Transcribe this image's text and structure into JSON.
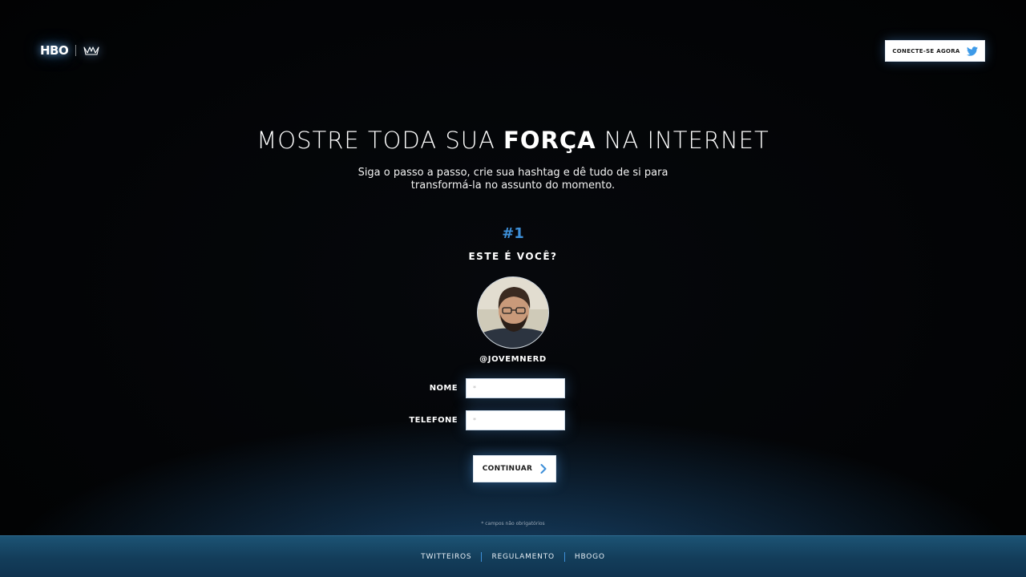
{
  "header": {
    "logo_text": "HBO",
    "connect_label": "CONECTE-SE AGORA",
    "connect_icon": "twitter-bird-icon",
    "crown_icon": "crown-icon"
  },
  "hero": {
    "headline_pre": "MOSTRE TODA SUA ",
    "headline_bold": "FORÇA",
    "headline_post": " NA INTERNET",
    "subtitle": "Siga o passo a passo, crie sua hashtag e dê tudo de si para transformá-la no assunto do momento."
  },
  "step": {
    "number": "#1",
    "question": "ESTE É VOCÊ?",
    "handle": "@JOVEMNERD"
  },
  "form": {
    "nome_label": "NOME",
    "nome_placeholder": "*",
    "telefone_label": "TELEFONE",
    "telefone_placeholder": "*",
    "continue_label": "CONTINUAR",
    "required_note": "* campos não obrigatórios"
  },
  "footer": {
    "links": [
      "TWITTEIROS",
      "REGULAMENTO",
      "HBOGO"
    ]
  },
  "colors": {
    "accent": "#3d8fd8",
    "twitter": "#3d9ae8",
    "footer_bg": "#133d5a"
  }
}
